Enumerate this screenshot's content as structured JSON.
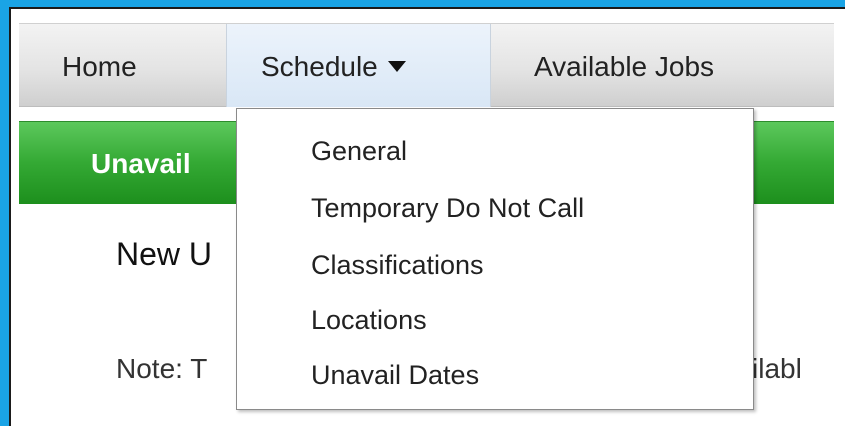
{
  "nav": {
    "items": [
      {
        "label": "Home"
      },
      {
        "label": "Schedule"
      },
      {
        "label": "Available Jobs"
      }
    ]
  },
  "section": {
    "title": "Unavail",
    "subheading": "New U",
    "note_left": "Note: T",
    "note_right": "ilabl"
  },
  "dropdown": {
    "items": [
      {
        "label": "General"
      },
      {
        "label": "Temporary Do Not Call"
      },
      {
        "label": "Classifications"
      },
      {
        "label": "Locations"
      },
      {
        "label": "Unavail Dates"
      }
    ]
  },
  "colors": {
    "frame": "#1aa4e6",
    "header_green": "#34a934",
    "active_tab": "#d9e7f6"
  },
  "icons": {
    "schedule_caret": "caret-down-icon"
  }
}
